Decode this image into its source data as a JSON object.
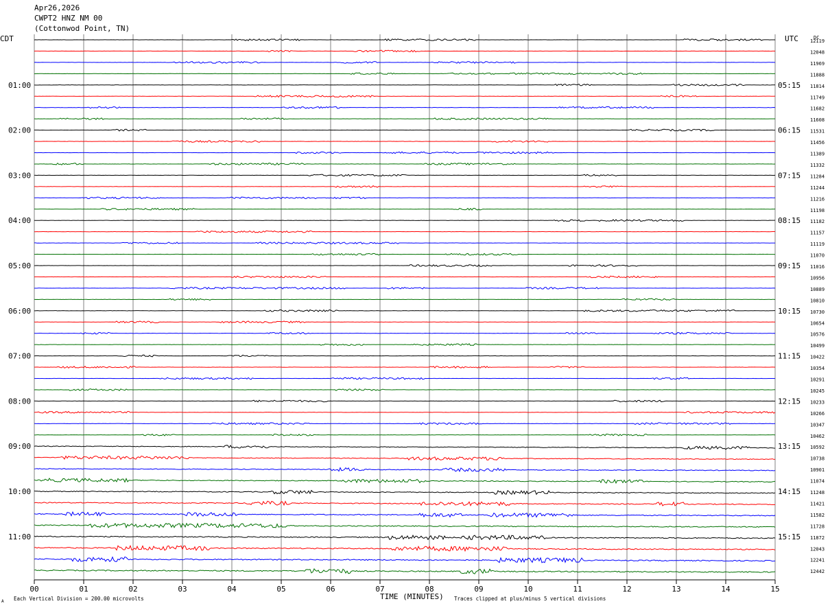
{
  "header": {
    "date": "Apr26,2026",
    "station": "CWPT2 HNZ NM 00",
    "location": "(Cottonwod Point, TN)"
  },
  "labels": {
    "left_timezone": "CDT",
    "right_timezone": "UTC",
    "dc_header": "DC",
    "x_axis_title": "TIME (MINUTES)",
    "footer_left": "Each Vertical Division =  200.00 microvolts",
    "footer_right": "Traces clipped at plus/minus 5 vertical divisions",
    "footer_mark": "A"
  },
  "chart_data": {
    "type": "line",
    "title": "",
    "xlabel": "TIME (MINUTES)",
    "ylabel": "",
    "xlim": [
      0,
      15
    ],
    "x_ticks": [
      "00",
      "01",
      "02",
      "03",
      "04",
      "05",
      "06",
      "07",
      "08",
      "09",
      "10",
      "11",
      "12",
      "13",
      "14",
      "15"
    ],
    "grid": true,
    "trace_count": 48,
    "trace_colors": [
      "#000000",
      "#ff0000",
      "#0000ff",
      "#007000"
    ],
    "left_hour_labels": [
      "01:00",
      "02:00",
      "03:00",
      "04:00",
      "05:00",
      "06:00",
      "07:00",
      "08:00",
      "09:00",
      "10:00",
      "11:00"
    ],
    "right_hour_labels": [
      "05:15",
      "06:15",
      "07:15",
      "08:15",
      "09:15",
      "10:15",
      "11:15",
      "12:15",
      "13:15",
      "14:15",
      "15:15"
    ],
    "dc_offsets": [
      12119,
      12048,
      11969,
      11888,
      11814,
      11749,
      11682,
      11608,
      11531,
      11456,
      11389,
      11332,
      11284,
      11244,
      11216,
      11198,
      11182,
      11157,
      11119,
      11070,
      11016,
      10956,
      10889,
      10810,
      10730,
      10654,
      10576,
      10499,
      10422,
      10354,
      10291,
      10245,
      10233,
      10266,
      10347,
      10462,
      10592,
      10738,
      10901,
      11074,
      11248,
      11421,
      11582,
      11728,
      11872,
      12043,
      12241,
      12442
    ]
  }
}
